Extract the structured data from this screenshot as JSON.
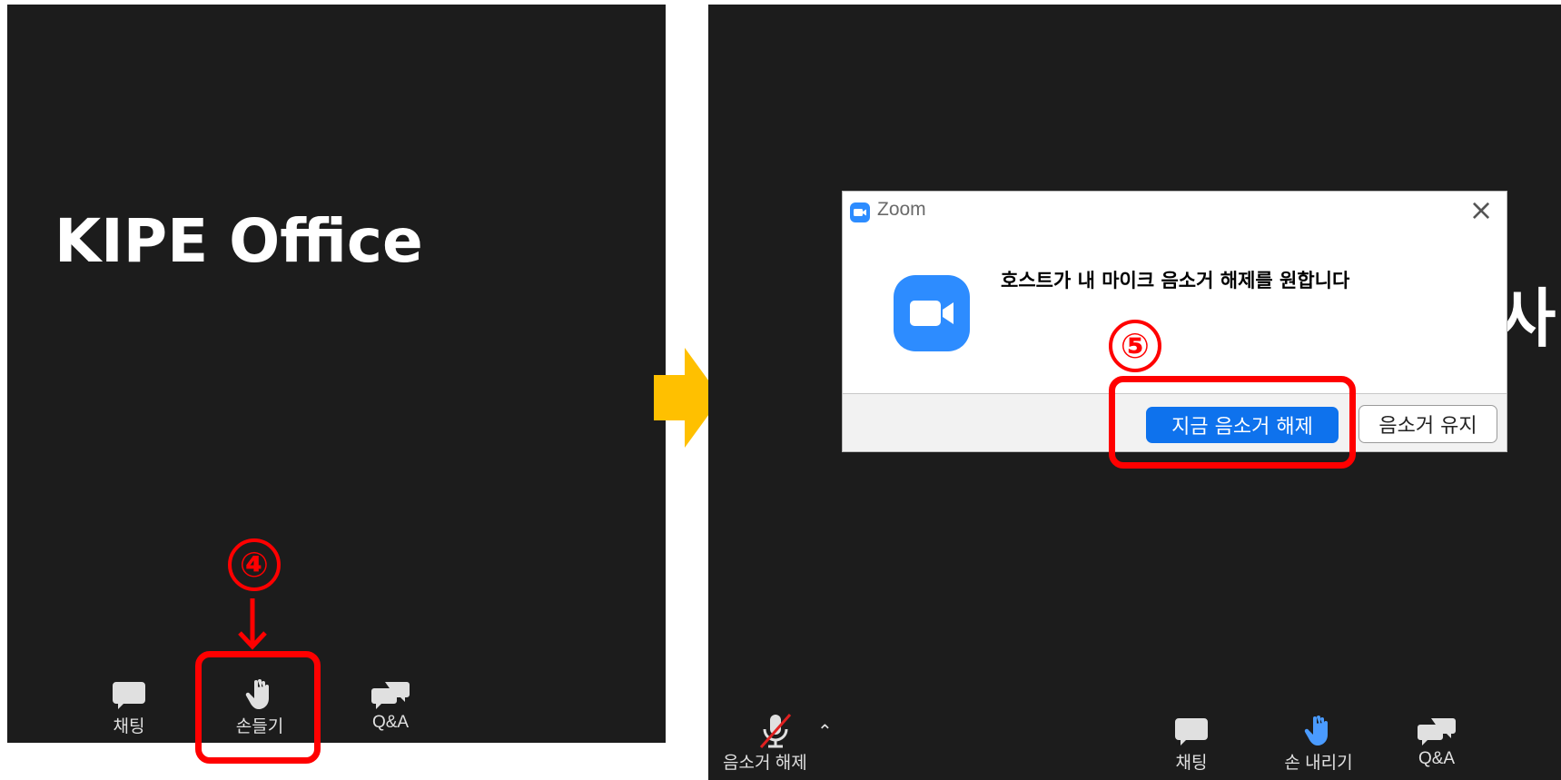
{
  "left_panel": {
    "room_title": "KIPE Office",
    "toolbar": {
      "chat_label": "채팅",
      "raise_hand_label": "손들기",
      "qa_label": "Q&A"
    },
    "step_marker": "④"
  },
  "right_panel": {
    "partial_text": "사",
    "dialog": {
      "title": "Zoom",
      "message": "호스트가 내 마이크 음소거 해제를 원합니다",
      "primary_button": "지금 음소거 해제",
      "secondary_button": "음소거 유지"
    },
    "step_marker": "⑤",
    "toolbar": {
      "unmute_label": "음소거 해제",
      "chat_label": "채팅",
      "lower_hand_label": "손 내리기",
      "qa_label": "Q&A"
    }
  },
  "colors": {
    "panel_bg": "#1c1c1c",
    "highlight": "#ff0000",
    "zoom_blue": "#2d8cff",
    "arrow": "#ffc000"
  },
  "icons": [
    "chat-icon",
    "hand-icon",
    "qa-icon",
    "zoom-camera-icon",
    "close-icon",
    "mic-off-icon",
    "caret-up-icon"
  ]
}
